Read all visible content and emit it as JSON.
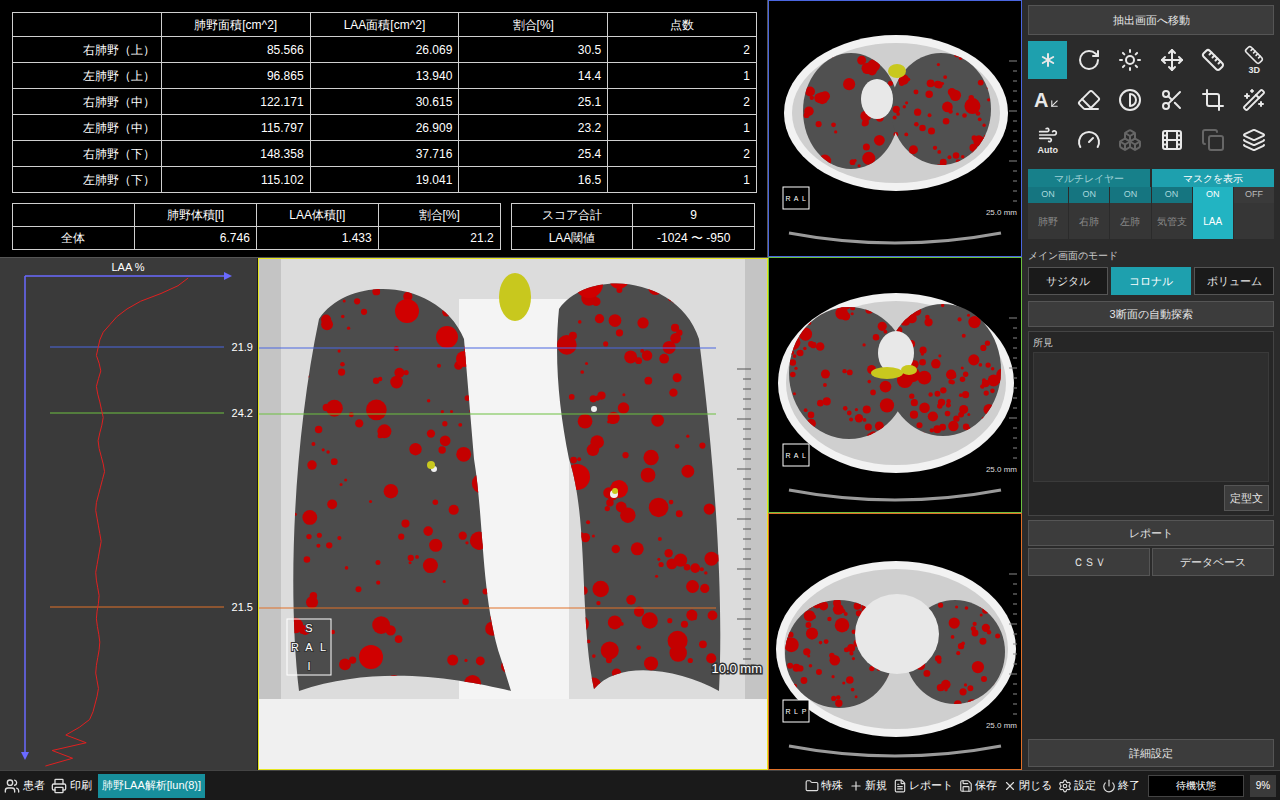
{
  "table": {
    "columns": [
      "",
      "肺野面積[cm^2]",
      "LAA面積[cm^2]",
      "割合[%]",
      "点数"
    ],
    "rows": [
      [
        "右肺野（上）",
        "85.566",
        "26.069",
        "30.5",
        "2"
      ],
      [
        "左肺野（上）",
        "96.865",
        "13.940",
        "14.4",
        "1"
      ],
      [
        "右肺野（中）",
        "122.171",
        "30.615",
        "25.1",
        "2"
      ],
      [
        "左肺野（中）",
        "115.797",
        "26.909",
        "23.2",
        "1"
      ],
      [
        "右肺野（下）",
        "148.358",
        "37.716",
        "25.4",
        "2"
      ],
      [
        "左肺野（下）",
        "115.102",
        "19.041",
        "16.5",
        "1"
      ]
    ]
  },
  "summary": {
    "columns": [
      "",
      "肺野体積[l]",
      "LAA体積[l]",
      "割合[%]"
    ],
    "row": [
      "全体",
      "6.746",
      "1.433",
      "21.2"
    ]
  },
  "score": [
    {
      "label": "スコア合計",
      "value": "9"
    },
    {
      "label": "LAA閾値",
      "value": "-1024 〜 -950"
    }
  ],
  "graph": {
    "title": "LAA %",
    "values": [
      48,
      45,
      40,
      34,
      30,
      27,
      25,
      23,
      22,
      21.5,
      21,
      21.8,
      22.3,
      21.6,
      21,
      21.4,
      22,
      22.5,
      23,
      22.6,
      22,
      21.5,
      21.8,
      22.4,
      23,
      23.4,
      22.8,
      22.2,
      21.6,
      21,
      20.8,
      21.2,
      21.6,
      22,
      22.4,
      22,
      21.6,
      21.2,
      20.8,
      21,
      21.4,
      21.8,
      21.6,
      21.2,
      21,
      21.3,
      21.7,
      22,
      21.8,
      21.4,
      21,
      20.8,
      21.2,
      21.6,
      21.2,
      20.6,
      20,
      19,
      16,
      12,
      18,
      8,
      14,
      6
    ],
    "markers": [
      {
        "label": "21.9",
        "color": "#4a66e0"
      },
      {
        "label": "24.2",
        "color": "#6cc040"
      },
      {
        "label": "21.5",
        "color": "#e07028"
      }
    ]
  },
  "coronal": {
    "orientation": {
      "top": "S",
      "left": "R",
      "center": "A",
      "right": "L",
      "bottom": "I"
    },
    "scale": "10.0 mm"
  },
  "axial": [
    {
      "scale": "25.0 mm",
      "orientation": [
        "R",
        "A",
        "L"
      ]
    },
    {
      "scale": "25.0 mm",
      "orientation": [
        "R",
        "A",
        "L"
      ]
    },
    {
      "scale": "25.0 mm",
      "orientation": [
        "R",
        "L",
        "P"
      ]
    }
  ],
  "toolbar": {
    "jump_button": "抽出画面へ移動",
    "tools": [
      {
        "kind": "icon",
        "selected": true,
        "disabled": false
      },
      {
        "kind": "icon",
        "selected": false,
        "disabled": false
      },
      {
        "kind": "icon",
        "selected": false,
        "disabled": false
      },
      {
        "kind": "icon",
        "selected": false,
        "disabled": false
      },
      {
        "kind": "icon",
        "selected": false,
        "disabled": false
      },
      {
        "kind": "badge",
        "label": "3D",
        "selected": false,
        "disabled": false
      },
      {
        "kind": "letter",
        "label": "A",
        "selected": false,
        "disabled": false
      },
      {
        "kind": "icon",
        "selected": false,
        "disabled": false
      },
      {
        "kind": "icon",
        "selected": false,
        "disabled": false
      },
      {
        "kind": "icon",
        "selected": false,
        "disabled": false
      },
      {
        "kind": "icon",
        "selected": false,
        "disabled": false
      },
      {
        "kind": "icon",
        "selected": false,
        "disabled": false
      },
      {
        "kind": "badge",
        "label": "Auto",
        "selected": false,
        "disabled": false
      },
      {
        "kind": "icon",
        "selected": false,
        "disabled": false
      },
      {
        "kind": "icon",
        "selected": false,
        "disabled": true
      },
      {
        "kind": "icon",
        "selected": false,
        "disabled": false
      },
      {
        "kind": "icon",
        "selected": false,
        "disabled": true
      },
      {
        "kind": "icon",
        "selected": false,
        "disabled": false
      }
    ]
  },
  "mask_tabs": [
    {
      "label": "マルチレイヤー",
      "selected": false
    },
    {
      "label": "マスクを表示",
      "selected": true
    }
  ],
  "layers": [
    {
      "state": "ON",
      "label": "肺野",
      "on": true,
      "selected": false
    },
    {
      "state": "ON",
      "label": "右肺",
      "on": true,
      "selected": false
    },
    {
      "state": "ON",
      "label": "左肺",
      "on": true,
      "selected": false
    },
    {
      "state": "ON",
      "label": "気管支",
      "on": true,
      "selected": false
    },
    {
      "state": "ON",
      "label": "LAA",
      "on": true,
      "selected": true
    },
    {
      "state": "OFF",
      "label": "",
      "on": false,
      "selected": false
    }
  ],
  "mode": {
    "title": "メイン画面のモード",
    "options": [
      {
        "label": "サジタル",
        "selected": false
      },
      {
        "label": "コロナル",
        "selected": true
      },
      {
        "label": "ボリューム",
        "selected": false
      }
    ]
  },
  "auto_search": "3断面の自動探索",
  "findings": {
    "title": "所見",
    "template_button": "定型文"
  },
  "report": {
    "title": "レポート",
    "buttons": [
      "ＣＳＶ",
      "データベース"
    ]
  },
  "detail_button": "詳細設定",
  "taskbar": {
    "left": [
      "患者",
      "印刷"
    ],
    "active_tab": "肺野LAA解析[lun(8)]",
    "right": [
      "特殊",
      "新規",
      "レポート",
      "保存",
      "閉じる",
      "設定",
      "終了"
    ],
    "status": "待機状態",
    "progress": "9%"
  }
}
